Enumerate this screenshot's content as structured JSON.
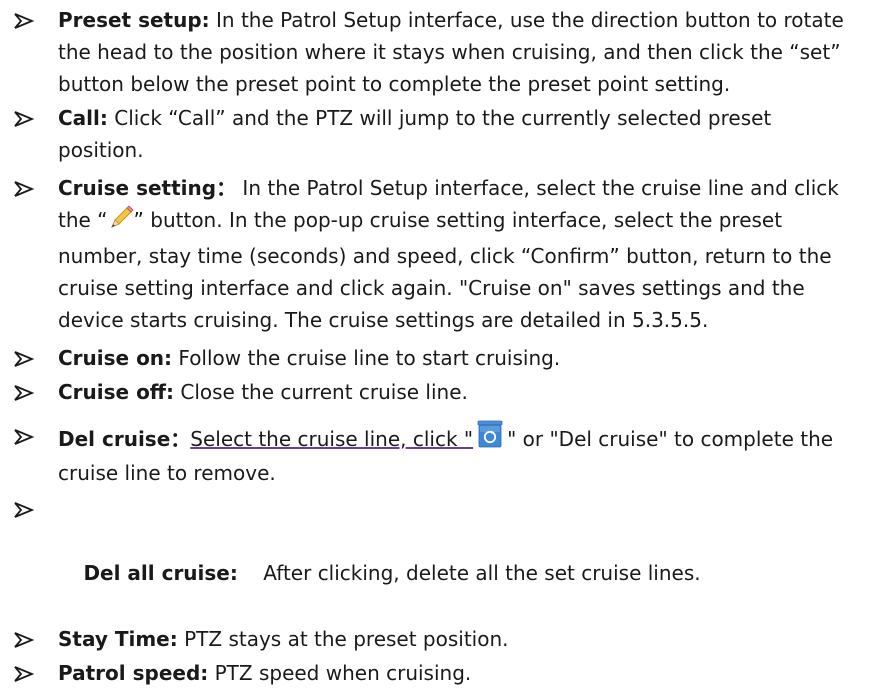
{
  "items": [
    {
      "term": "Preset setup:",
      "text": " In the Patrol Setup interface, use the direction button to rotate the head to the position where it stays when cruising, and then click the “set” button below the preset point to complete the preset point setting."
    },
    {
      "term": "Call:",
      "text": " Click “Call” and the PTZ will jump to the currently selected preset position."
    },
    {
      "term": "Cruise setting：",
      "text_before_icon": " In the Patrol Setup interface, select the cruise line and click the “",
      "icon": "pencil-icon",
      "text_after_icon": "” button. In the pop-up cruise setting interface, select the preset number, stay time (seconds) and speed, click “Confirm” button, return to the cruise setting interface and click again. \"Cruise on\" saves settings and the device starts cruising. The cruise settings are detailed in 5.3.5.5."
    },
    {
      "term": "Cruise on:",
      "text": " Follow the cruise line to start cruising."
    },
    {
      "term": "Cruise off:",
      "text": " Close the current cruise line."
    },
    {
      "term": "Del cruise：",
      "text_before_icon": "Select the cruise line, click \"",
      "icon": "recycle-bin-icon",
      "text_after_icon": "\" or \"Del cruise\" to complete the cruise line to remove."
    },
    {
      "term": "Del all cruise:",
      "text": "    After clicking, delete all the set cruise lines."
    },
    {
      "term": "Stay Time:",
      "text": " PTZ stays at the preset position."
    },
    {
      "term": "Patrol speed:",
      "text": " PTZ speed when cruising."
    }
  ]
}
